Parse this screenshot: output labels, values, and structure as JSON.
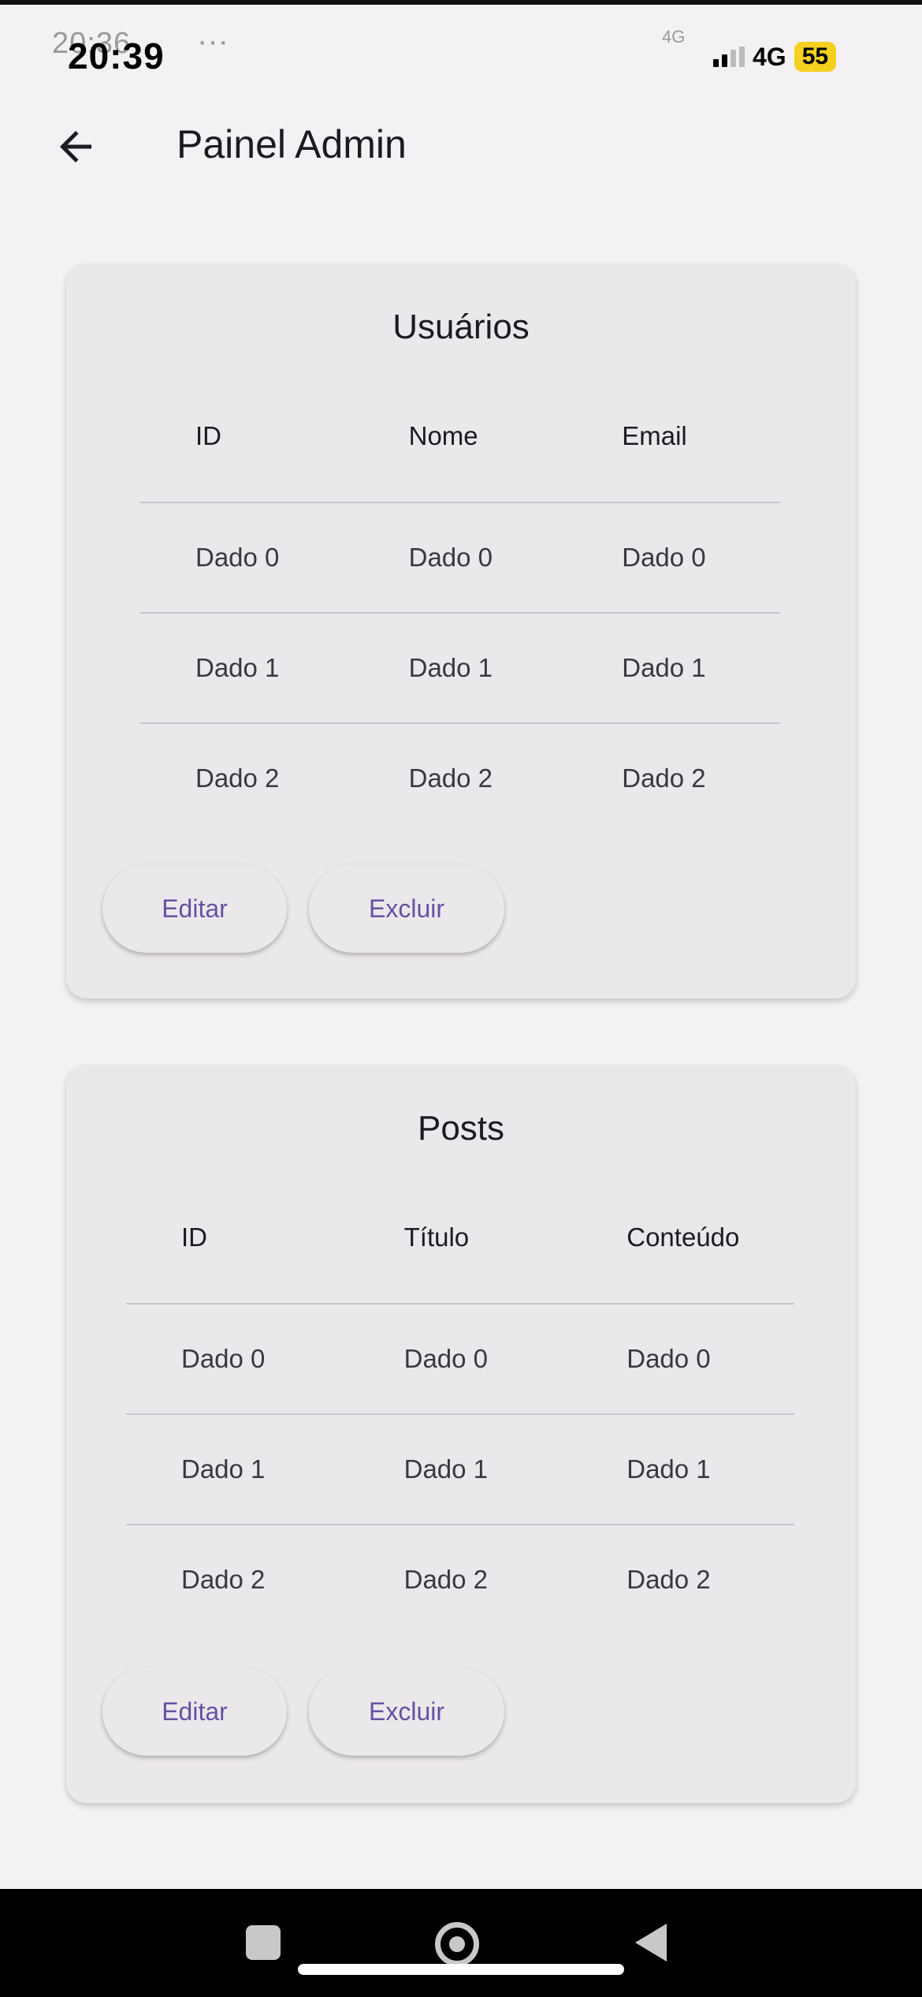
{
  "status_bar": {
    "time": "20:39",
    "ghost_time": "20:36",
    "ghost_dots": "···",
    "network": "4G",
    "ghost_network": "4G",
    "battery": "55"
  },
  "app_bar": {
    "title": "Painel Admin",
    "back_icon": "arrow-left-icon"
  },
  "users_card": {
    "title": "Usuários",
    "columns": [
      "ID",
      "Nome",
      "Email"
    ],
    "rows": [
      [
        "Dado 0",
        "Dado 0",
        "Dado 0"
      ],
      [
        "Dado 1",
        "Dado 1",
        "Dado 1"
      ],
      [
        "Dado 2",
        "Dado 2",
        "Dado 2"
      ]
    ],
    "edit_label": "Editar",
    "delete_label": "Excluir"
  },
  "posts_card": {
    "title": "Posts",
    "columns": [
      "ID",
      "Título",
      "Conteúdo"
    ],
    "rows": [
      [
        "Dado 0",
        "Dado 0",
        "Dado 0"
      ],
      [
        "Dado 1",
        "Dado 1",
        "Dado 1"
      ],
      [
        "Dado 2",
        "Dado 2",
        "Dado 2"
      ]
    ],
    "edit_label": "Editar",
    "delete_label": "Excluir"
  },
  "colors": {
    "accent": "#6750a4",
    "background": "#f3f1f4",
    "card": "#ebe8ec",
    "battery": "#f5d020"
  }
}
